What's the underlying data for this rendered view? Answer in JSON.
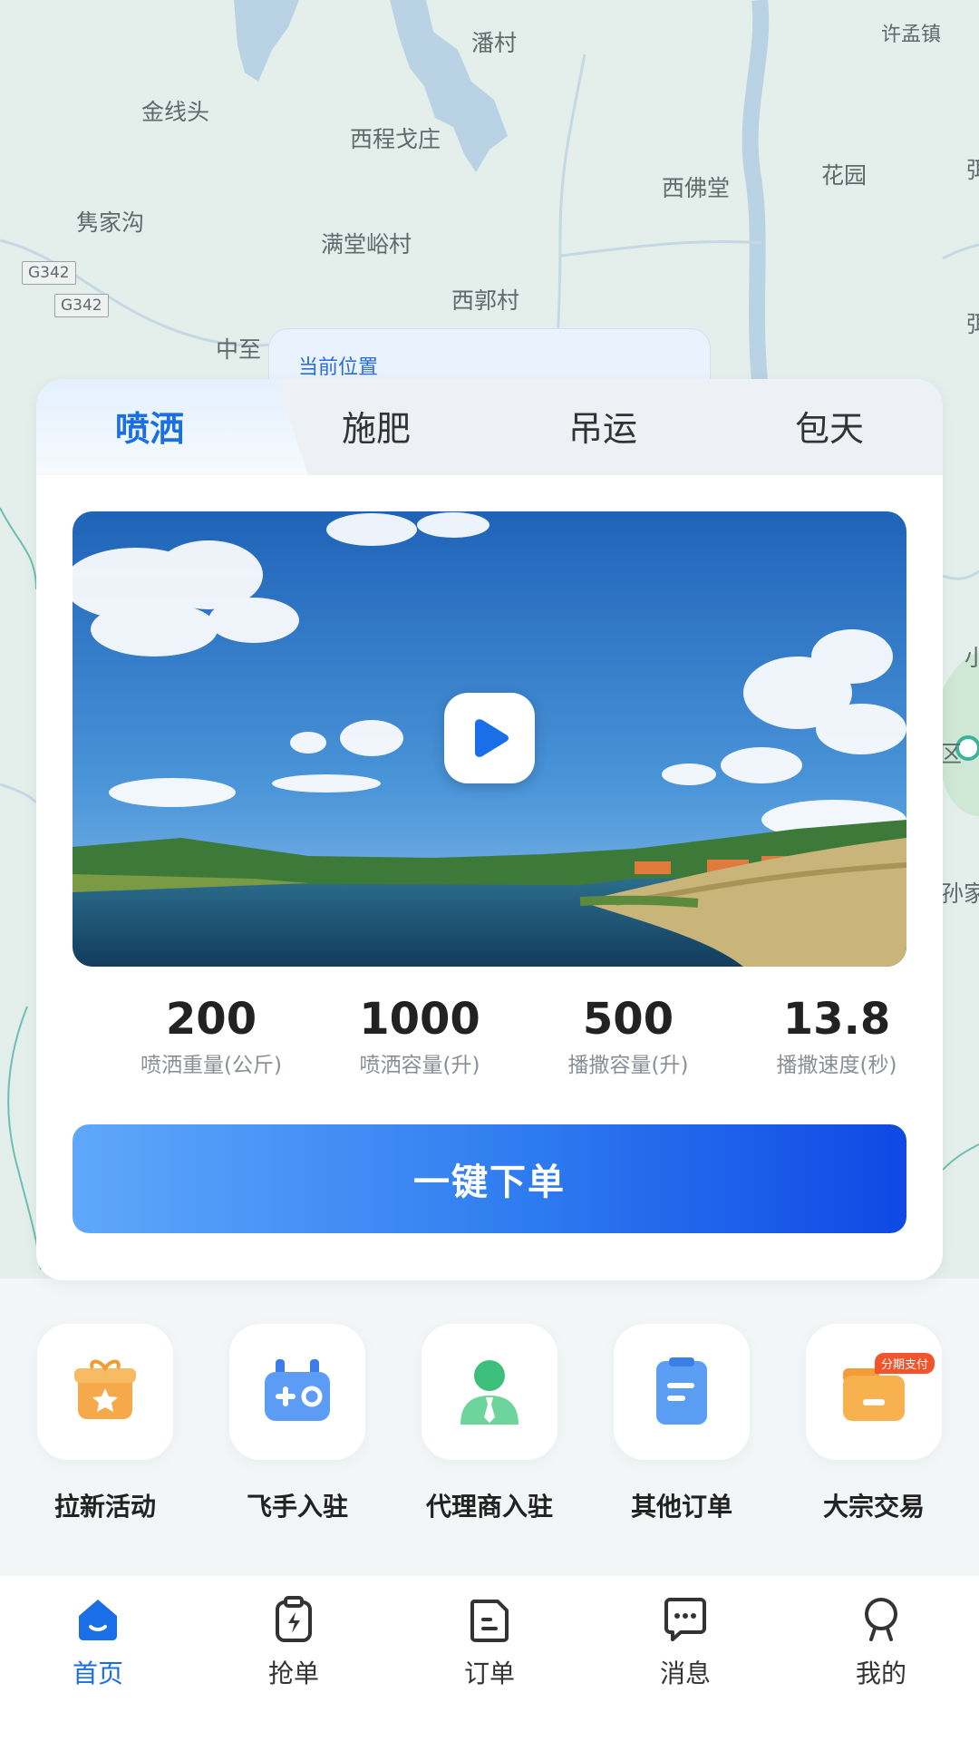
{
  "map": {
    "location_tab_label": "当前位置",
    "labels": [
      "潘村",
      "许孟镇",
      "金线头",
      "西程戈庄",
      "西佛堂",
      "花园",
      "隽家沟",
      "满堂峪村",
      "西郭村",
      "中至",
      "小",
      "孙家",
      "弭",
      "弭",
      "区"
    ],
    "road_tags": [
      "G342",
      "G342"
    ]
  },
  "tabs": [
    {
      "label": "喷洒",
      "active": true
    },
    {
      "label": "施肥",
      "active": false
    },
    {
      "label": "吊运",
      "active": false
    },
    {
      "label": "包天",
      "active": false
    }
  ],
  "video": {
    "icon": "play-icon"
  },
  "stats": [
    {
      "value": "200",
      "label": "喷洒重量(公斤)"
    },
    {
      "value": "1000",
      "label": "喷洒容量(升)"
    },
    {
      "value": "500",
      "label": "播撒容量(升)"
    },
    {
      "value": "13.8",
      "label": "播撒速度(秒)"
    }
  ],
  "order_button_label": "一键下单",
  "quick_actions": [
    {
      "label": "拉新活动",
      "icon": "gift-box-icon"
    },
    {
      "label": "飞手入驻",
      "icon": "gamepad-controller-icon"
    },
    {
      "label": "代理商入驻",
      "icon": "agent-person-icon"
    },
    {
      "label": "其他订单",
      "icon": "document-icon"
    },
    {
      "label": "大宗交易",
      "icon": "folder-box-icon",
      "badge": "分期支付"
    }
  ],
  "bottom_nav": [
    {
      "label": "首页",
      "icon": "home-icon",
      "active": true
    },
    {
      "label": "抢单",
      "icon": "grab-order-icon",
      "active": false
    },
    {
      "label": "订单",
      "icon": "order-doc-icon",
      "active": false
    },
    {
      "label": "消息",
      "icon": "message-icon",
      "active": false
    },
    {
      "label": "我的",
      "icon": "profile-icon",
      "active": false
    }
  ],
  "colors": {
    "accent": "#1a6fe8",
    "button_start": "#5fa8fb",
    "button_end": "#0f48e4",
    "badge": "#f2552c"
  }
}
